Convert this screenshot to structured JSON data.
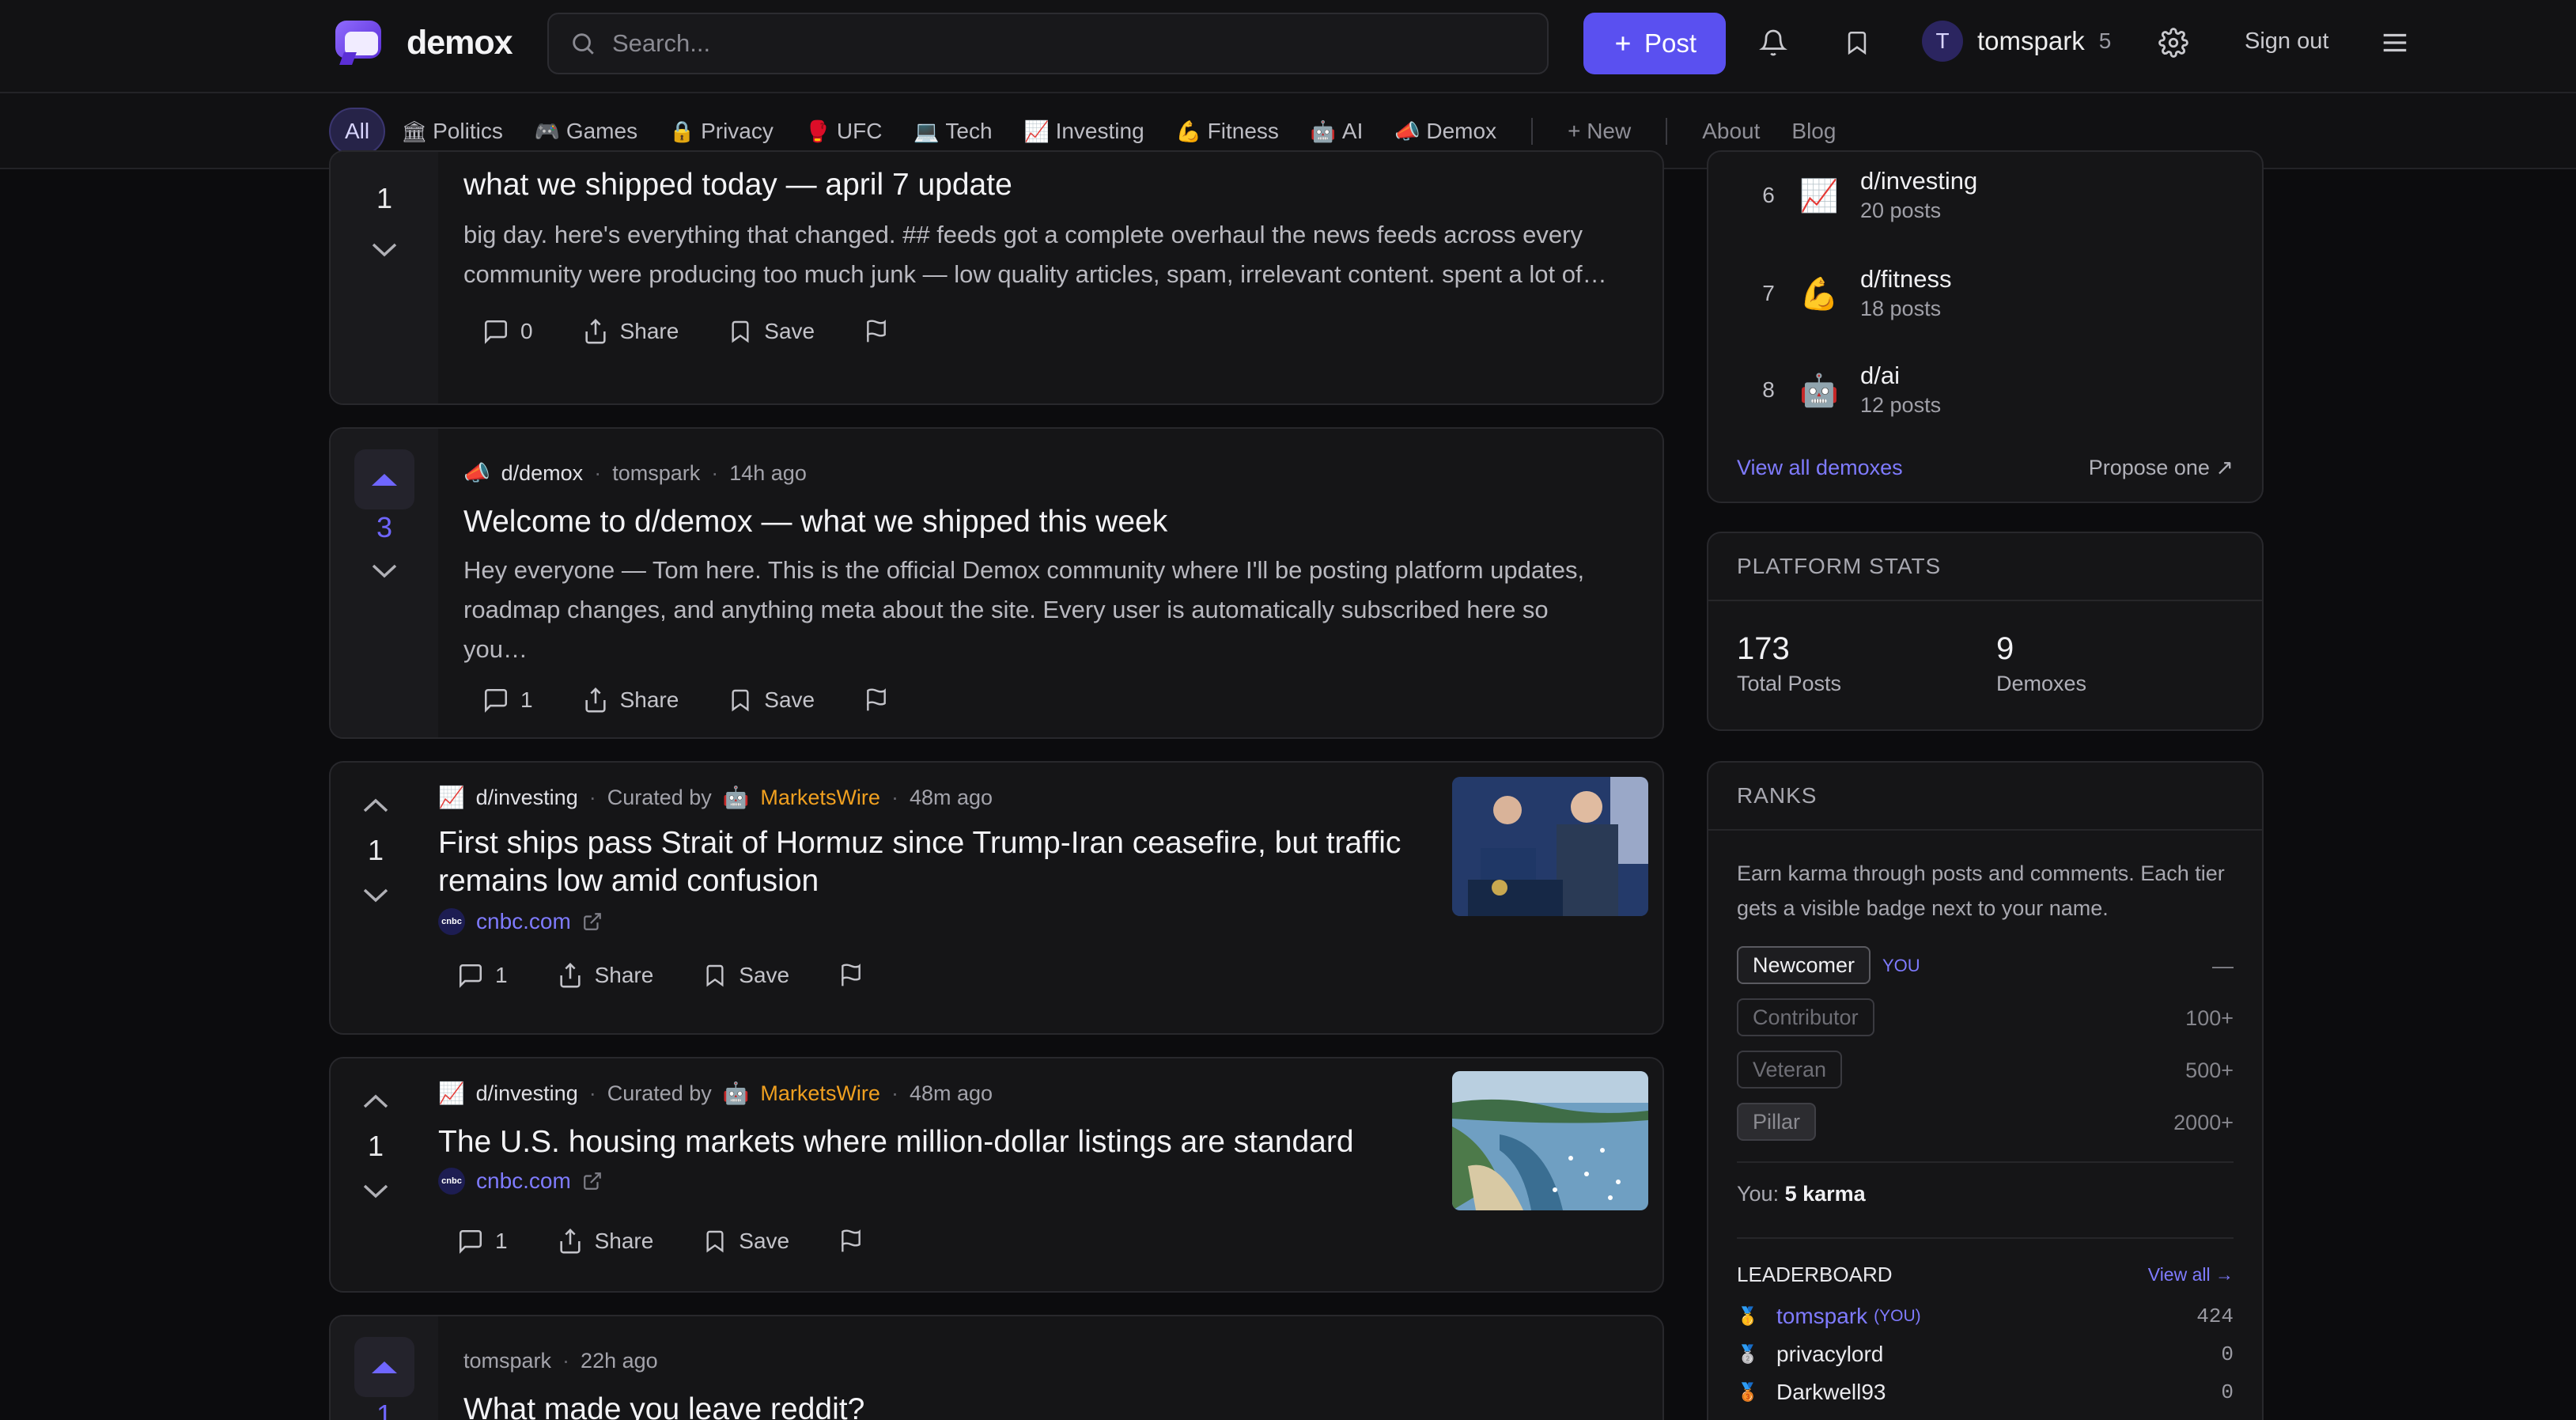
{
  "app": {
    "name": "demox"
  },
  "header": {
    "search_placeholder": "Search...",
    "post_label": "Post",
    "user": {
      "initial": "T",
      "name": "tomspark",
      "karma": "5"
    },
    "signout_label": "Sign out"
  },
  "categories": [
    {
      "label": "All",
      "icon": ""
    },
    {
      "label": "Politics",
      "icon": "🏛"
    },
    {
      "label": "Games",
      "icon": "🎮"
    },
    {
      "label": "Privacy",
      "icon": "🔒"
    },
    {
      "label": "UFC",
      "icon": "🥊"
    },
    {
      "label": "Tech",
      "icon": "💻"
    },
    {
      "label": "Investing",
      "icon": "📈"
    },
    {
      "label": "Fitness",
      "icon": "💪"
    },
    {
      "label": "AI",
      "icon": "🤖"
    },
    {
      "label": "Demox",
      "icon": "📣"
    }
  ],
  "nav_extra": {
    "new_label": "+ New",
    "about_label": "About",
    "blog_label": "Blog"
  },
  "posts": [
    {
      "votes": "1",
      "title": "what we shipped today — april 7 update",
      "body": "big day. here's everything that changed. ## feeds got a complete overhaul the news feeds across every community were producing too much junk — low quality articles, spam, irrelevant content. spent a lot of…",
      "comments": "0",
      "share": "Share",
      "save": "Save"
    },
    {
      "votes": "3",
      "sub": "d/demox",
      "sub_icon": "📣",
      "author": "tomspark",
      "time": "14h ago",
      "title": "Welcome to d/demox — what we shipped this week",
      "body": "Hey everyone — Tom here. This is the official Demox community where I'll be posting platform updates, roadmap changes, and anything meta about the site. Every user is automatically subscribed here so you…",
      "comments": "1",
      "share": "Share",
      "save": "Save"
    },
    {
      "votes": "1",
      "sub": "d/investing",
      "sub_icon": "📈",
      "curated_by": "Curated by",
      "curator": "MarketsWire",
      "time": "48m ago",
      "title": "First ships pass Strait of Hormuz since Trump-Iran ceasefire, but traffic remains low amid confusion",
      "source": "cnbc.com",
      "source_badge": "cnbc",
      "comments": "1",
      "share": "Share",
      "save": "Save"
    },
    {
      "votes": "1",
      "sub": "d/investing",
      "sub_icon": "📈",
      "curated_by": "Curated by",
      "curator": "MarketsWire",
      "time": "48m ago",
      "title": "The U.S. housing markets where million-dollar listings are standard",
      "source": "cnbc.com",
      "source_badge": "cnbc",
      "comments": "1",
      "share": "Share",
      "save": "Save"
    },
    {
      "votes": "1",
      "author": "tomspark",
      "time": "22h ago",
      "title": "What made you leave reddit?"
    }
  ],
  "communities": {
    "items": [
      {
        "rank": "6",
        "icon": "📈",
        "name": "d/investing",
        "count": "20 posts"
      },
      {
        "rank": "7",
        "icon": "💪",
        "name": "d/fitness",
        "count": "18 posts"
      },
      {
        "rank": "8",
        "icon": "🤖",
        "name": "d/ai",
        "count": "12 posts"
      }
    ],
    "view_all": "View all demoxes",
    "propose": "Propose one ↗"
  },
  "stats": {
    "heading": "PLATFORM STATS",
    "total_posts": "173",
    "total_posts_label": "Total Posts",
    "demoxes": "9",
    "demoxes_label": "Demoxes"
  },
  "ranks": {
    "heading": "RANKS",
    "desc": "Earn karma through posts and comments. Each tier gets a visible badge next to your name.",
    "tiers": [
      {
        "name": "Newcomer",
        "req": "—",
        "you": "YOU"
      },
      {
        "name": "Contributor",
        "req": "100+"
      },
      {
        "name": "Veteran",
        "req": "500+"
      },
      {
        "name": "Pillar",
        "req": "2000+"
      }
    ],
    "you_label": "You:",
    "you_karma": "5 karma",
    "leaderboard_heading": "LEADERBOARD",
    "view_all": "View all →",
    "leaders": [
      {
        "name": "tomspark",
        "tag": "(YOU)",
        "points": "424",
        "medal": "🥇"
      },
      {
        "name": "privacylord",
        "points": "0",
        "medal": "🥈"
      },
      {
        "name": "Darkwell93",
        "points": "0",
        "medal": "🥉"
      }
    ]
  },
  "colors": {
    "accent": "#5a50f0",
    "link": "#7f7bff",
    "curator": "#f0a020",
    "background": "#0c0c0e",
    "card": "#151517"
  }
}
